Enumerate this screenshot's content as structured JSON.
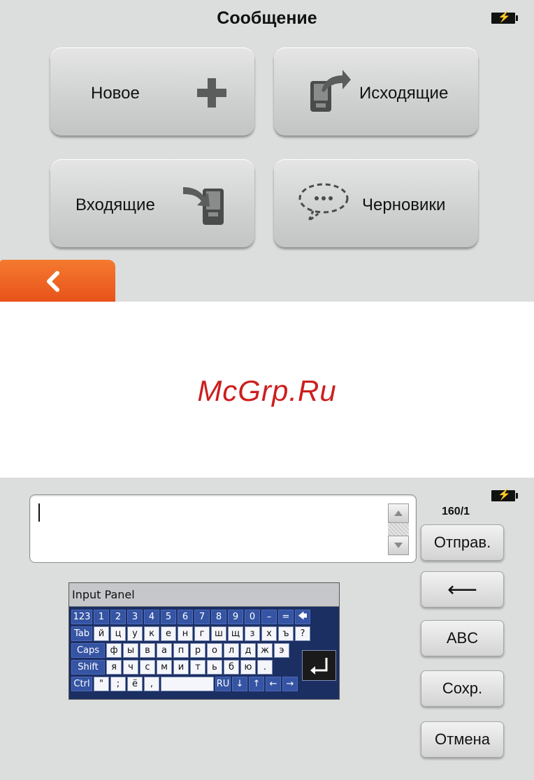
{
  "screen1": {
    "title": "Сообщение",
    "buttons": {
      "new": "Новое",
      "outbox": "Исходящие",
      "inbox": "Входящие",
      "drafts": "Черновики"
    }
  },
  "watermark": "McGrp.Ru",
  "screen2": {
    "message_text": "",
    "counter": "160/1",
    "side_buttons": {
      "send": "Отправ.",
      "backspace": "⟵",
      "abc": "ABC",
      "save": "Сохр.",
      "cancel": "Отмена"
    },
    "input_panel": {
      "title": "Input Panel",
      "rows": [
        [
          "123",
          "1",
          "2",
          "3",
          "4",
          "5",
          "6",
          "7",
          "8",
          "9",
          "0",
          "–",
          "=",
          "🡄"
        ],
        [
          "Tab",
          "й",
          "ц",
          "у",
          "к",
          "е",
          "н",
          "г",
          "ш",
          "щ",
          "з",
          "х",
          "ъ",
          "?"
        ],
        [
          "Caps",
          "ф",
          "ы",
          "в",
          "а",
          "п",
          "р",
          "о",
          "л",
          "д",
          "ж",
          "э"
        ],
        [
          "Shift",
          "я",
          "ч",
          "с",
          "м",
          "и",
          "т",
          "ь",
          "б",
          "ю",
          "."
        ],
        [
          "Ctrl",
          "\"",
          "; ",
          "ё",
          ",",
          "",
          "RU",
          "↓",
          "↑",
          "←",
          "→"
        ]
      ]
    }
  }
}
